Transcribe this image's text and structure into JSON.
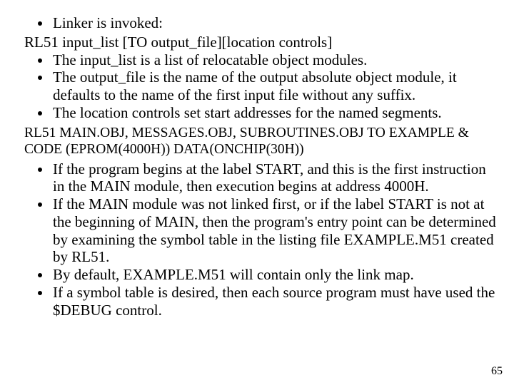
{
  "section_a": {
    "bullets": [
      "Linker is invoked:"
    ],
    "invocation": "RL51 input_list [TO output_file][location controls]",
    "bullets2": [
      "The input_list is a list of relocatable object modules.",
      "The output_file is the name of the output absolute object module, it defaults to the name of the first input file without any suffix.",
      "The location controls set start addresses for the named segments."
    ]
  },
  "example": "RL51 MAIN.OBJ, MESSAGES.OBJ, SUBROUTINES.OBJ TO EXAMPLE & CODE (EPROM(4000H)) DATA(ONCHIP(30H))",
  "section_b": {
    "bullets": [
      "If the program begins at the label START, and this is the first instruction in the MAIN module, then execution begins at address 4000H.",
      "If the MAIN module was not linked first, or if the label START is not at the beginning of MAIN, then the program's entry point can be determined by examining the symbol table in the listing file EXAMPLE.M51 created by RL51.",
      "By default, EXAMPLE.M51 will contain only the link map.",
      "If a symbol table is desired, then each source program must have used the $DEBUG control."
    ]
  },
  "page_number": "65"
}
